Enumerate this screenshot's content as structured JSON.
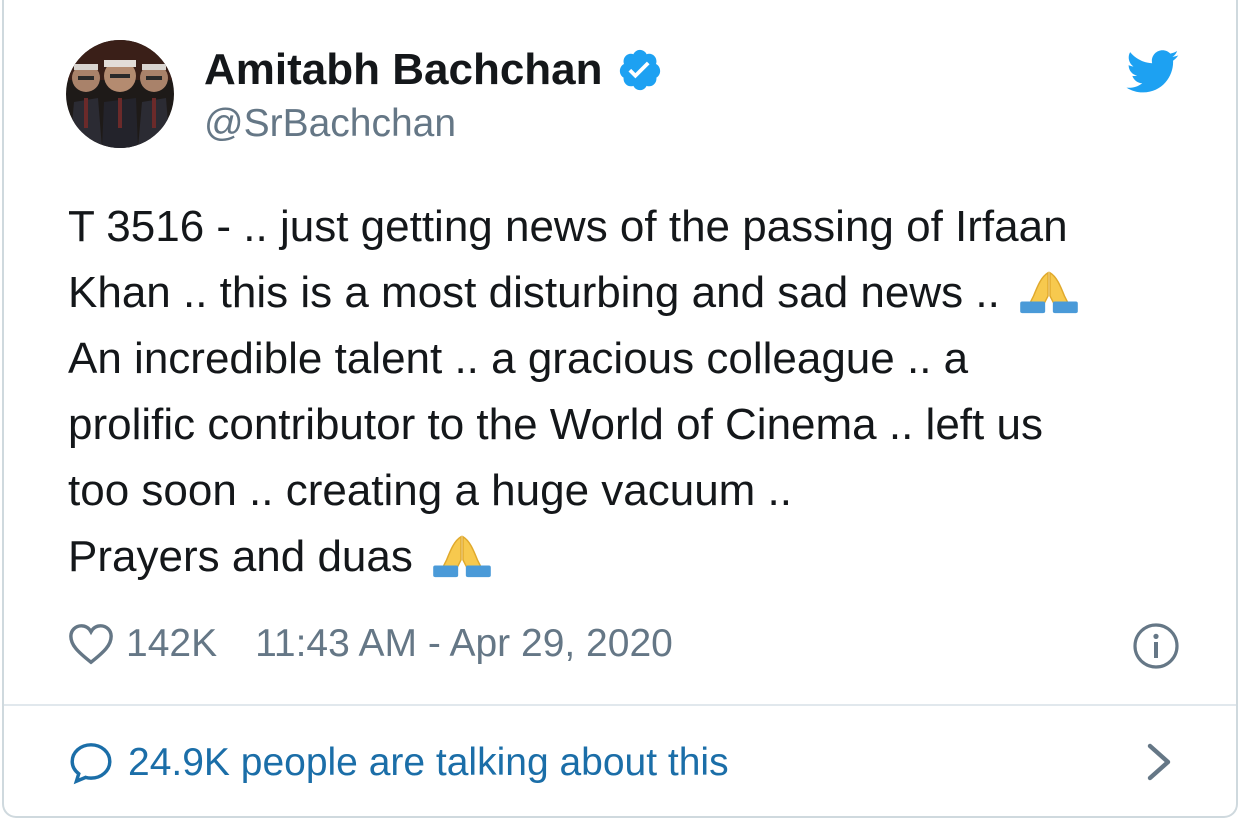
{
  "author": {
    "display_name": "Amitabh Bachchan",
    "handle": "@SrBachchan",
    "verified": true
  },
  "tweet": {
    "lines": [
      "T 3516 - .. just getting news of the passing of Irfaan",
      "Khan .. this is a most disturbing and sad news .. ",
      "An incredible talent .. a gracious colleague .. a",
      "prolific contributor to the World of Cinema .. left us",
      "too soon .. creating a huge vacuum ..",
      "Prayers and duas "
    ],
    "emoji": "folded-hands"
  },
  "meta": {
    "likes": "142K",
    "timestamp": "11:43 AM - Apr 29, 2020"
  },
  "footer": {
    "talking": "24.9K people are talking about this"
  },
  "icons": {
    "brand": "twitter-bird-icon",
    "verified": "verified-badge-icon",
    "like": "heart-icon",
    "info": "info-icon",
    "reply": "speech-bubble-icon",
    "more": "chevron-right-icon"
  },
  "colors": {
    "brand_blue": "#1da1f2",
    "link_blue": "#1b6ea8",
    "muted": "#657786",
    "text": "#14171a",
    "border": "#cfd9de"
  }
}
